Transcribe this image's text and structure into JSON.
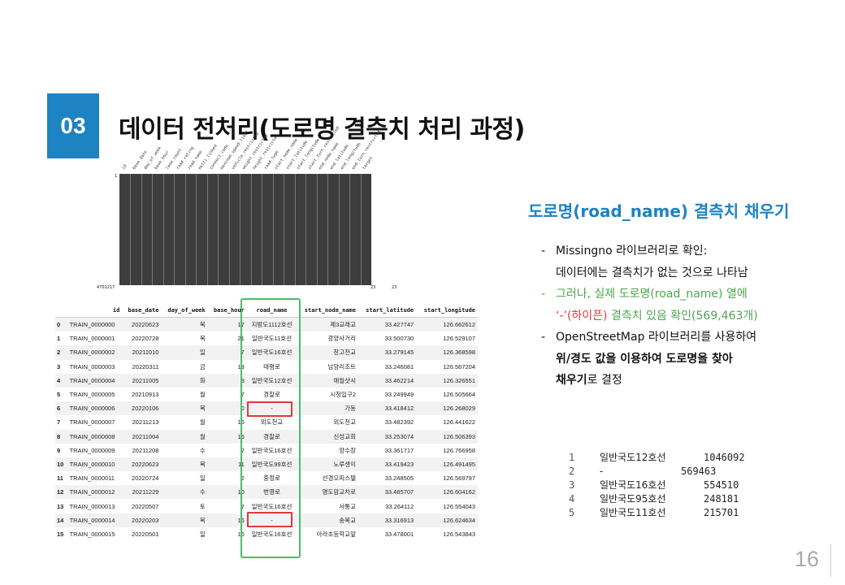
{
  "header": {
    "number": "03",
    "title": "데이터 전처리(도로명 결측치 처리 과정)"
  },
  "chart": {
    "columns": [
      "id",
      "base_date",
      "day_of_week",
      "base_hour",
      "lane_count",
      "road_rating",
      "road_name",
      "multi_linked",
      "connect_code",
      "maximum_speed_limit",
      "vehicle_restricted",
      "weight_restricted",
      "height_restricted",
      "road_type",
      "start_node_name",
      "start_latitude",
      "start_longitude",
      "start_turn_restricted",
      "end_node_name",
      "end_latitude",
      "end_longitude",
      "end_turn_restricted",
      "target"
    ],
    "y_top": "1",
    "y_bottom": "4701217",
    "right_top": "23",
    "right_bottom": "23",
    "right_bottom2": "23"
  },
  "table": {
    "headers": [
      "",
      "id",
      "base_date",
      "day_of_week",
      "base_hour",
      "road_name",
      "start_node_name",
      "start_latitude",
      "start_longitude"
    ],
    "rows": [
      [
        "0",
        "TRAIN_0000000",
        "20220623",
        "목",
        "17",
        "지방도1112호선",
        "제3교래교",
        "33.427747",
        "126.662612"
      ],
      [
        "1",
        "TRAIN_0000001",
        "20220728",
        "목",
        "21",
        "일반국도11호선",
        "광양사거리",
        "33.500730",
        "126.529107"
      ],
      [
        "2",
        "TRAIN_0000002",
        "20211010",
        "일",
        "7",
        "일반국도16호선",
        "창고천교",
        "33.279145",
        "126.368598"
      ],
      [
        "3",
        "TRAIN_0000003",
        "20220311",
        "금",
        "13",
        "태평로",
        "남양리조트",
        "33.246081",
        "126.567204"
      ],
      [
        "4",
        "TRAIN_0000004",
        "20211005",
        "화",
        "8",
        "일반국도12호선",
        "애월샷시",
        "33.462214",
        "126.326551"
      ],
      [
        "5",
        "TRAIN_0000005",
        "20210913",
        "월",
        "7",
        "경찰로",
        "시청입구2",
        "33.249949",
        "126.505664"
      ],
      [
        "6",
        "TRAIN_0000006",
        "20220106",
        "목",
        "0",
        "-",
        "가동",
        "33.418412",
        "126.268029"
      ],
      [
        "7",
        "TRAIN_0000007",
        "20211213",
        "월",
        "16",
        "외도천교",
        "외도천교",
        "33.482392",
        "126.441622"
      ],
      [
        "8",
        "TRAIN_0000008",
        "20211004",
        "월",
        "15",
        "경찰로",
        "신성교회",
        "33.253074",
        "126.506393"
      ],
      [
        "9",
        "TRAIN_0000009",
        "20211208",
        "수",
        "2",
        "일반국도16호선",
        "양수장",
        "33.361717",
        "126.766958"
      ],
      [
        "10",
        "TRAIN_0000010",
        "20220623",
        "목",
        "11",
        "일반국도99호선",
        "노루생이",
        "33.419423",
        "126.491495"
      ],
      [
        "11",
        "TRAIN_0000011",
        "20220724",
        "일",
        "2",
        "중정로",
        "선경오피스텔",
        "33.248505",
        "126.569797"
      ],
      [
        "12",
        "TRAIN_0000012",
        "20211229",
        "수",
        "10",
        "번영로",
        "명도암교차로",
        "33.485707",
        "126.604162"
      ],
      [
        "13",
        "TRAIN_0000013",
        "20220507",
        "토",
        "7",
        "일반국도16호선",
        "서통교",
        "33.264112",
        "126.554043"
      ],
      [
        "14",
        "TRAIN_0000014",
        "20220203",
        "목",
        "16",
        "-",
        "송목교",
        "33.316913",
        "126.624634"
      ],
      [
        "15",
        "TRAIN_0000015",
        "20220501",
        "일",
        "16",
        "일반국도16호선",
        "아라초등학교앞",
        "33.478001",
        "126.543843"
      ]
    ]
  },
  "right": {
    "subtitle": "도로명(road_name) 결측치 채우기",
    "b1_l1": "Missingno 라이브러리로 확인:",
    "b1_l2": "데이터에는 결측치가 없는 것으로 나타남",
    "b2_l1": "그러나, 실제 도로명(road_name) 열에",
    "b2_l2_red": "‘-’(하이픈)",
    "b2_l2_rest": " 결측치 있음 확인(569,463개)",
    "b3_l1": "OpenStreetMap 라이브러리를 사용하여",
    "b3_l2": "위/경도 값을 이용하여 도로명을 찾아",
    "b3_l3_bold": "채우기",
    "b3_l3_rest": "로 결정",
    "dash": "-"
  },
  "value_counts": [
    {
      "n": "1",
      "name": "일반국도12호선",
      "count": "1046092"
    },
    {
      "n": "2",
      "name": "-",
      "count": "569463"
    },
    {
      "n": "3",
      "name": "일반국도16호선",
      "count": "554510"
    },
    {
      "n": "4",
      "name": "일반국도95호선",
      "count": "248181"
    },
    {
      "n": "5",
      "name": "일반국도11호선",
      "count": "215701"
    }
  ],
  "page_number": "16",
  "colors": {
    "accent": "#1e83c2",
    "green": "#4da651",
    "red": "#e23a3a"
  }
}
